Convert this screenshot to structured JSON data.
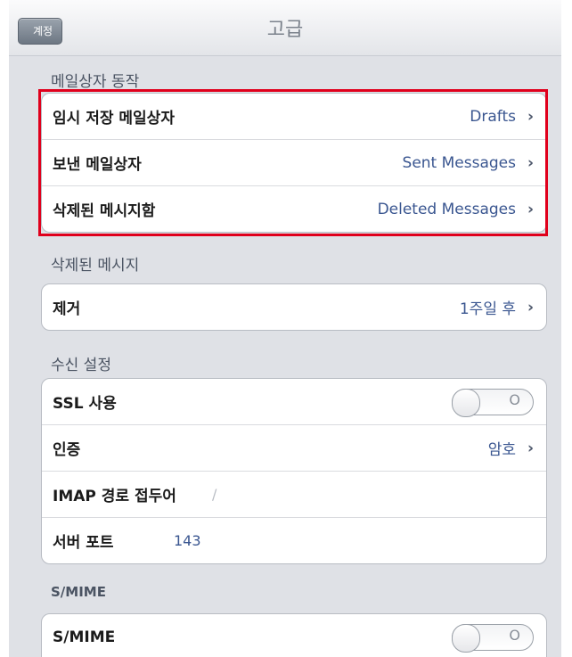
{
  "nav": {
    "back": "계정",
    "title": "고급"
  },
  "sections": {
    "mailbox_behaviors": {
      "header": "메일상자 동작",
      "rows": [
        {
          "label": "임시 저장 메일상자",
          "value": "Drafts"
        },
        {
          "label": "보낸 메일상자",
          "value": "Sent Messages"
        },
        {
          "label": "삭제된 메시지함",
          "value": "Deleted Messages"
        }
      ]
    },
    "deleted_messages": {
      "header": "삭제된 메시지",
      "rows": [
        {
          "label": "제거",
          "value": "1주일 후"
        }
      ]
    },
    "incoming": {
      "header": "수신 설정",
      "ssl_label": "SSL 사용",
      "ssl_toggle": "O",
      "auth_label": "인증",
      "auth_value": "암호",
      "imap_label": "IMAP 경로 접두어",
      "imap_value": "/",
      "port_label": "서버 포트",
      "port_value": "143"
    },
    "smime": {
      "header": "S/MIME",
      "label": "S/MIME",
      "toggle": "O"
    }
  },
  "icons": {
    "chevron": "›"
  },
  "colors": {
    "highlight": "#e0001c",
    "value_text": "#3a5690"
  }
}
